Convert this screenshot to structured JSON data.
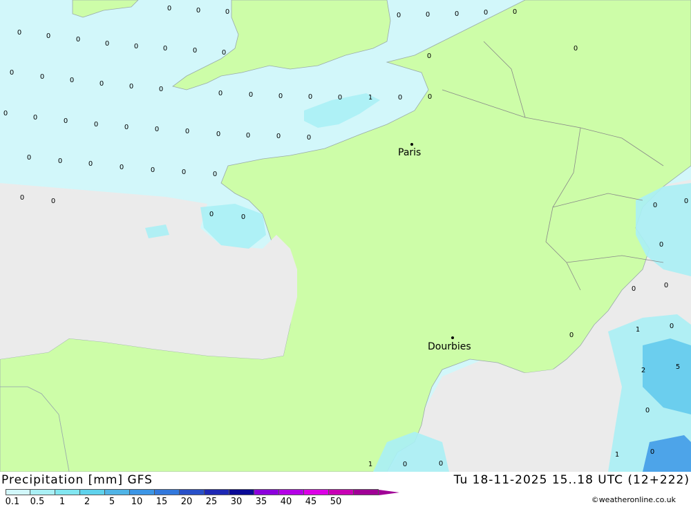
{
  "colors": {
    "sea": "#d2f7fa",
    "land": "#cdfda8",
    "outside": "#ebebeb",
    "precip_light": "#aaf0f5",
    "precip_mid": "#5fc8ec",
    "precip_heavy": "#3c96e6",
    "border": "#888888"
  },
  "cities": [
    {
      "name": "Paris"
    },
    {
      "name": "Dourbies"
    }
  ],
  "value_labels": [
    "0",
    "0",
    "0",
    "0",
    "0",
    "0",
    "0",
    "0",
    "0",
    "0",
    "0",
    "0",
    "0",
    "0",
    "0",
    "0",
    "0",
    "0",
    "0",
    "0",
    "0",
    "0",
    "0",
    "0",
    "0",
    "0",
    "0",
    "0",
    "0",
    "0",
    "0",
    "0",
    "0",
    "0",
    "0",
    "0",
    "0",
    "0",
    "0",
    "1",
    "0",
    "0",
    "0",
    "0",
    "0",
    "0",
    "0",
    "0",
    "0",
    "0",
    "0",
    "0",
    "0",
    "0",
    "0",
    "0",
    "0",
    "0",
    "0",
    "0",
    "0",
    "0",
    "0",
    "0",
    "0",
    "0",
    "0",
    "0",
    "0",
    "0",
    "1",
    "0",
    "0",
    "0",
    "0",
    "1",
    "0",
    "1",
    "2",
    "0",
    "1",
    "2",
    "5",
    "0",
    "1",
    "0"
  ],
  "footer": {
    "title": "Precipitation [mm] GFS",
    "time": "Tu 18-11-2025 15..18 UTC (12+222)",
    "credit": "©weatheronline.co.uk"
  },
  "legend": {
    "ticks": [
      "0.1",
      "0.5",
      "1",
      "2",
      "5",
      "10",
      "15",
      "20",
      "25",
      "30",
      "35",
      "40",
      "45",
      "50"
    ],
    "colors": [
      "#d2f7fa",
      "#aaf0f5",
      "#82e6f0",
      "#5fd2ec",
      "#50b4e6",
      "#3c96e6",
      "#3278dc",
      "#2850c8",
      "#1e28b4",
      "#0a0a96",
      "#8c00dc",
      "#b400e6",
      "#dc00e6",
      "#c800b4",
      "#a00096"
    ]
  }
}
